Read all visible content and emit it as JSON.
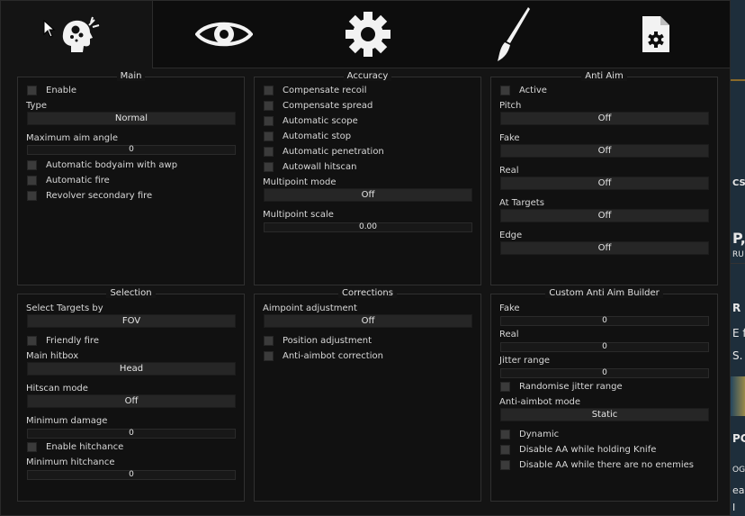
{
  "tabs": [
    {
      "name": "tab-ragebot",
      "icon": "brain-head-icon",
      "active": true
    },
    {
      "name": "tab-visuals",
      "icon": "eye-icon",
      "active": false
    },
    {
      "name": "tab-misc",
      "icon": "gear-icon",
      "active": false
    },
    {
      "name": "tab-skins",
      "icon": "paintbrush-icon",
      "active": false
    },
    {
      "name": "tab-config",
      "icon": "config-file-icon",
      "active": false
    }
  ],
  "background_text": {
    "t1": "CS",
    "t2": "P,",
    "t3": "RU",
    "t4": "R",
    "t5": "E f",
    "t6": "S.",
    "t7": "PC",
    "t8": "OG",
    "t9": "ear",
    "t10": "I"
  },
  "main": {
    "title": "Main",
    "enable": "Enable",
    "type_label": "Type",
    "type_value": "Normal",
    "max_aim_label": "Maximum aim angle",
    "max_aim_value": "0",
    "bodyaim_awp": "Automatic bodyaim with awp",
    "auto_fire": "Automatic fire",
    "revolver": "Revolver secondary fire"
  },
  "accuracy": {
    "title": "Accuracy",
    "recoil": "Compensate recoil",
    "spread": "Compensate spread",
    "scope": "Automatic scope",
    "stop": "Automatic stop",
    "penetration": "Automatic penetration",
    "autowall": "Autowall hitscan",
    "multipoint_mode_label": "Multipoint mode",
    "multipoint_mode_value": "Off",
    "multipoint_scale_label": "Multipoint scale",
    "multipoint_scale_value": "0.00"
  },
  "antiaim": {
    "title": "Anti Aim",
    "active": "Active",
    "pitch_label": "Pitch",
    "pitch_value": "Off",
    "fake_label": "Fake",
    "fake_value": "Off",
    "real_label": "Real",
    "real_value": "Off",
    "targets_label": "At Targets",
    "targets_value": "Off",
    "edge_label": "Edge",
    "edge_value": "Off"
  },
  "selection": {
    "title": "Selection",
    "targets_label": "Select Targets by",
    "targets_value": "FOV",
    "friendly_fire": "Friendly fire",
    "hitbox_label": "Main hitbox",
    "hitbox_value": "Head",
    "hitscan_label": "Hitscan mode",
    "hitscan_value": "Off",
    "min_damage_label": "Minimum damage",
    "min_damage_value": "0",
    "enable_hitchance": "Enable hitchance",
    "min_hitchance_label": "Minimum hitchance",
    "min_hitchance_value": "0"
  },
  "corrections": {
    "title": "Corrections",
    "aimpoint_label": "Aimpoint adjustment",
    "aimpoint_value": "Off",
    "position": "Position adjustment",
    "antiaimbot": "Anti-aimbot correction"
  },
  "builder": {
    "title": "Custom Anti Aim Builder",
    "fake_label": "Fake",
    "fake_value": "0",
    "real_label": "Real",
    "real_value": "0",
    "jitter_label": "Jitter range",
    "jitter_value": "0",
    "randomise": "Randomise jitter range",
    "mode_label": "Anti-aimbot mode",
    "mode_value": "Static",
    "dynamic": "Dynamic",
    "knife": "Disable AA while holding Knife",
    "no_enemies": "Disable AA while there are no enemies"
  }
}
